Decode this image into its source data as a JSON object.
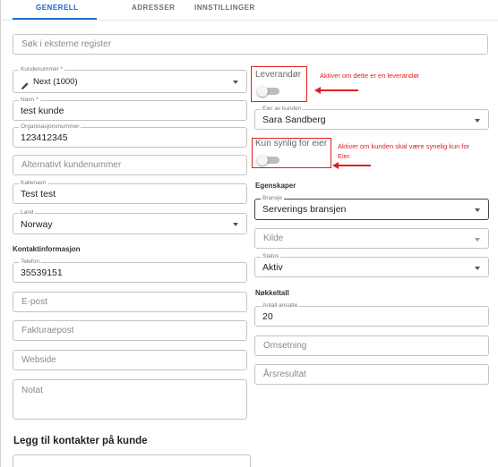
{
  "tabs": [
    {
      "label": "GENERELL",
      "active": true
    },
    {
      "label": "ADRESSER",
      "active": false
    },
    {
      "label": "INNSTILLINGER",
      "active": false
    }
  ],
  "search": {
    "placeholder": "Søk i eksterne register"
  },
  "left": {
    "customer_number": {
      "label": "Kundenummer *",
      "value": "Next (1000)"
    },
    "name": {
      "label": "Navn *",
      "value": "test kunde"
    },
    "org_number": {
      "label": "Organisasjonsnummer",
      "value": "123412345"
    },
    "alt_customer_number": {
      "placeholder": "Alternativt kundenummer"
    },
    "nickname": {
      "label": "Kallenavn",
      "value": "Test test"
    },
    "country": {
      "label": "Land",
      "value": "Norway"
    },
    "contact_heading": "Kontaktinformasjon",
    "phone": {
      "label": "Telefon",
      "value": "35539151"
    },
    "email": {
      "placeholder": "E-post"
    },
    "invoice_email": {
      "placeholder": "Fakturaepost"
    },
    "website": {
      "placeholder": "Webside"
    },
    "note": {
      "placeholder": "Notat"
    },
    "add_contacts_heading": "Legg til kontakter på kunde"
  },
  "right": {
    "supplier": {
      "label": "Leverandør",
      "on": false
    },
    "supplier_annotation": "Aktiver om dette er en leverandør",
    "owner": {
      "label": "Eier av kunden",
      "value": "Sara  Sandberg"
    },
    "owner_only": {
      "label": "Kun synlig for eier",
      "on": false
    },
    "owner_only_annotation_line1": "Aktiver om kunden skal være synelig kun for",
    "owner_only_annotation_line2": "Eier.",
    "properties_heading": "Egenskaper",
    "industry": {
      "label": "Bransje",
      "value": "Serverings bransjen"
    },
    "source": {
      "placeholder": "Kilde"
    },
    "status": {
      "label": "Status",
      "value": "Aktiv"
    },
    "key_figures_heading": "Nøkkeltall",
    "employees": {
      "label": "Antall ansatte",
      "value": "20"
    },
    "revenue": {
      "placeholder": "Omsetning"
    },
    "annual_result": {
      "placeholder": "Årsresultat"
    }
  },
  "colors": {
    "accent": "#1976d2",
    "annotation": "#e02020",
    "border": "#c4c4c4"
  }
}
